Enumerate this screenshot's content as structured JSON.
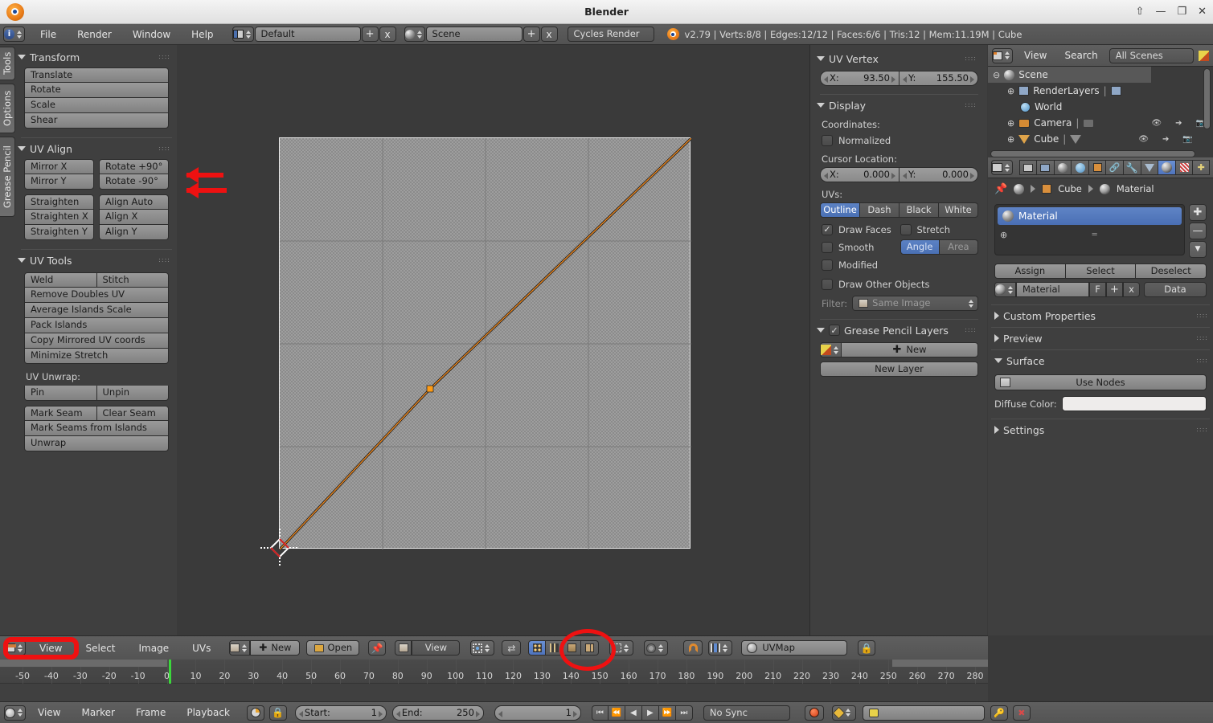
{
  "window": {
    "title": "Blender",
    "controls": [
      "restore-up",
      "minimize",
      "maximize",
      "close"
    ]
  },
  "menubar": {
    "editor_icon": "info-editor-icon",
    "menus": [
      "File",
      "Render",
      "Window",
      "Help"
    ],
    "screen_layout": {
      "icon": "screen-layout-icon",
      "value": "Default",
      "add": "+",
      "delete": "x"
    },
    "scene": {
      "icon": "scene-icon",
      "value": "Scene",
      "add": "+",
      "delete": "x"
    },
    "engine": "Cycles Render",
    "status": "v2.79 | Verts:8/8 | Edges:12/12 | Faces:6/6 | Tris:12 | Mem:11.19M | Cube"
  },
  "toolshelf": {
    "tabs": [
      "Tools",
      "Options",
      "Grease Pencil"
    ],
    "panels": [
      {
        "title": "Transform",
        "open": true,
        "rows": [
          [
            "Translate"
          ],
          [
            "Rotate"
          ],
          [
            "Scale"
          ],
          [
            "Shear"
          ]
        ]
      },
      {
        "title": "UV Align",
        "open": true,
        "rows": [
          [
            "Mirror X",
            "Rotate +90°"
          ],
          [
            "Mirror Y",
            "Rotate  -90°"
          ],
          [
            "Straighten",
            "Align Auto"
          ],
          [
            "Straighten X",
            "Align X"
          ],
          [
            "Straighten Y",
            "Align Y"
          ]
        ]
      },
      {
        "title": "UV Tools",
        "open": true,
        "rows": [
          [
            "Weld",
            "Stitch"
          ],
          [
            "Remove Doubles UV"
          ],
          [
            "Average Islands Scale"
          ],
          [
            "Pack Islands"
          ],
          [
            "Copy Mirrored UV coords"
          ],
          [
            "Minimize Stretch"
          ]
        ],
        "subtitle": "UV Unwrap:",
        "rows2": [
          [
            "Pin",
            "Unpin"
          ],
          [
            "Mark Seam",
            "Clear Seam"
          ],
          [
            "Mark Seams from Islands"
          ],
          [
            "Unwrap"
          ]
        ]
      }
    ]
  },
  "properties_n_panel": {
    "uv_vertex": {
      "title": "UV Vertex",
      "x": {
        "name": "X:",
        "value": "93.50"
      },
      "y": {
        "name": "Y:",
        "value": "155.50"
      }
    },
    "display": {
      "title": "Display",
      "coordinates_label": "Coordinates:",
      "normalized": {
        "label": "Normalized",
        "checked": false
      },
      "cursor_label": "Cursor Location:",
      "cursor_x": {
        "name": "X:",
        "value": "0.000"
      },
      "cursor_y": {
        "name": "Y:",
        "value": "0.000"
      },
      "uvs_label": "UVs:",
      "uv_modes": [
        "Outline",
        "Dash",
        "Black",
        "White"
      ],
      "uv_mode_active": "Outline",
      "draw_faces": {
        "label": "Draw Faces",
        "checked": true
      },
      "stretch": {
        "label": "Stretch",
        "checked": false
      },
      "smooth": {
        "label": "Smooth",
        "checked": false
      },
      "stretch_modes": [
        "Angle",
        "Area"
      ],
      "stretch_mode_active": "Angle",
      "modified": {
        "label": "Modified",
        "checked": false
      },
      "draw_other_objects": {
        "label": "Draw Other Objects",
        "checked": false
      },
      "filter_label": "Filter:",
      "filter_value": "Same Image"
    },
    "grease_pencil": {
      "title": "Grease Pencil Layers",
      "checked": true,
      "new_button": "New",
      "new_layer_button": "New Layer"
    }
  },
  "outliner": {
    "editor_icon": "outliner-editor-icon",
    "menus": [
      "View",
      "Search"
    ],
    "display_mode": "All Scenes",
    "rows": [
      {
        "label": "Scene",
        "icon": "scene-icon",
        "indent": 0,
        "expander": "minus",
        "selected": true
      },
      {
        "label": "RenderLayers",
        "icon": "renderlayers-icon",
        "indent": 1,
        "expander": "plus",
        "selected": false
      },
      {
        "label": "World",
        "icon": "world-icon",
        "indent": 1,
        "expander": "",
        "selected": false
      },
      {
        "label": "Camera",
        "icon": "camera-icon",
        "indent": 1,
        "expander": "plus",
        "selected": false,
        "restrict": true
      },
      {
        "label": "Cube",
        "icon": "mesh-icon",
        "indent": 1,
        "expander": "plus",
        "selected": false,
        "restrict": true
      }
    ]
  },
  "property_editor": {
    "tab_icons": [
      "render-icon",
      "render-layers-icon",
      "scene-icon",
      "world-icon",
      "object-icon",
      "constraints-icon",
      "modifier-icon",
      "data-icon",
      "material-icon",
      "texture-icon",
      "particles-icon"
    ],
    "active_tab": "material-icon",
    "breadcrumb": [
      "Cube",
      "Material"
    ],
    "material_slot": "Material",
    "slot_buttons": [
      "Assign",
      "Select",
      "Deselect"
    ],
    "datablock_name": "Material",
    "fake_user": "F",
    "add_button": "+",
    "unlink_button": "x",
    "type_selector": "Data",
    "panels": [
      {
        "title": "Custom Properties",
        "open": false
      },
      {
        "title": "Preview",
        "open": false
      },
      {
        "title": "Surface",
        "open": true
      },
      {
        "title": "Settings",
        "open": false
      }
    ],
    "use_nodes": "Use Nodes",
    "diffuse_color_label": "Diffuse Color:",
    "diffuse_color": "#eeeceb"
  },
  "uv_editor_header": {
    "editor_icon": "uv-editor-icon",
    "menus": [
      "View",
      "Select",
      "Image",
      "UVs"
    ],
    "image_new": "New",
    "image_open": "Open",
    "pin_icon": "pin-icon",
    "view_mode": "View",
    "uvmap_name": "UVMap",
    "lock_icon": "lock-icon",
    "snap_icon": "snap-magnet-icon",
    "snap_mode_icon": "snap-mode-icon",
    "pivot_icon": "pivot-icon",
    "proportional_icon": "proportional-edit-icon",
    "select_mode_icons": [
      "uv-vertex-select",
      "uv-edge-select",
      "uv-face-select",
      "uv-island-select"
    ],
    "sync_icon": "uv-sync-icon"
  },
  "timeline": {
    "editor_icon": "timeline-editor-icon",
    "menus": [
      "View",
      "Marker",
      "Frame",
      "Playback"
    ],
    "ticks": [
      -50,
      -40,
      -30,
      -20,
      -10,
      0,
      10,
      20,
      30,
      40,
      50,
      60,
      70,
      80,
      90,
      100,
      110,
      120,
      130,
      140,
      150,
      160,
      170,
      180,
      190,
      200,
      210,
      220,
      230,
      240,
      250,
      260,
      270,
      280
    ],
    "start": {
      "label": "Start:",
      "value": "1"
    },
    "end": {
      "label": "End:",
      "value": "250"
    },
    "current_frame": "1",
    "sync_mode": "No Sync",
    "record_icon": "record-icon",
    "keying_set_icon": "keyingset-icon",
    "keying_set_value": "",
    "playhead_frame": 1
  },
  "annotations": {
    "arrow_targets": [
      "Rotate +90°",
      "Rotate  -90°"
    ],
    "circled_uv_snap": true,
    "boxed_editor_type": true,
    "color": "#ee1111"
  },
  "uv_canvas": {
    "island_points": [
      [
        0.0,
        0.0
      ],
      [
        0.365,
        0.39
      ],
      [
        1.0,
        1.0
      ]
    ],
    "selected_vertex": [
      0.365,
      0.39
    ],
    "cursor_2d": [
      0.0,
      0.0
    ]
  }
}
